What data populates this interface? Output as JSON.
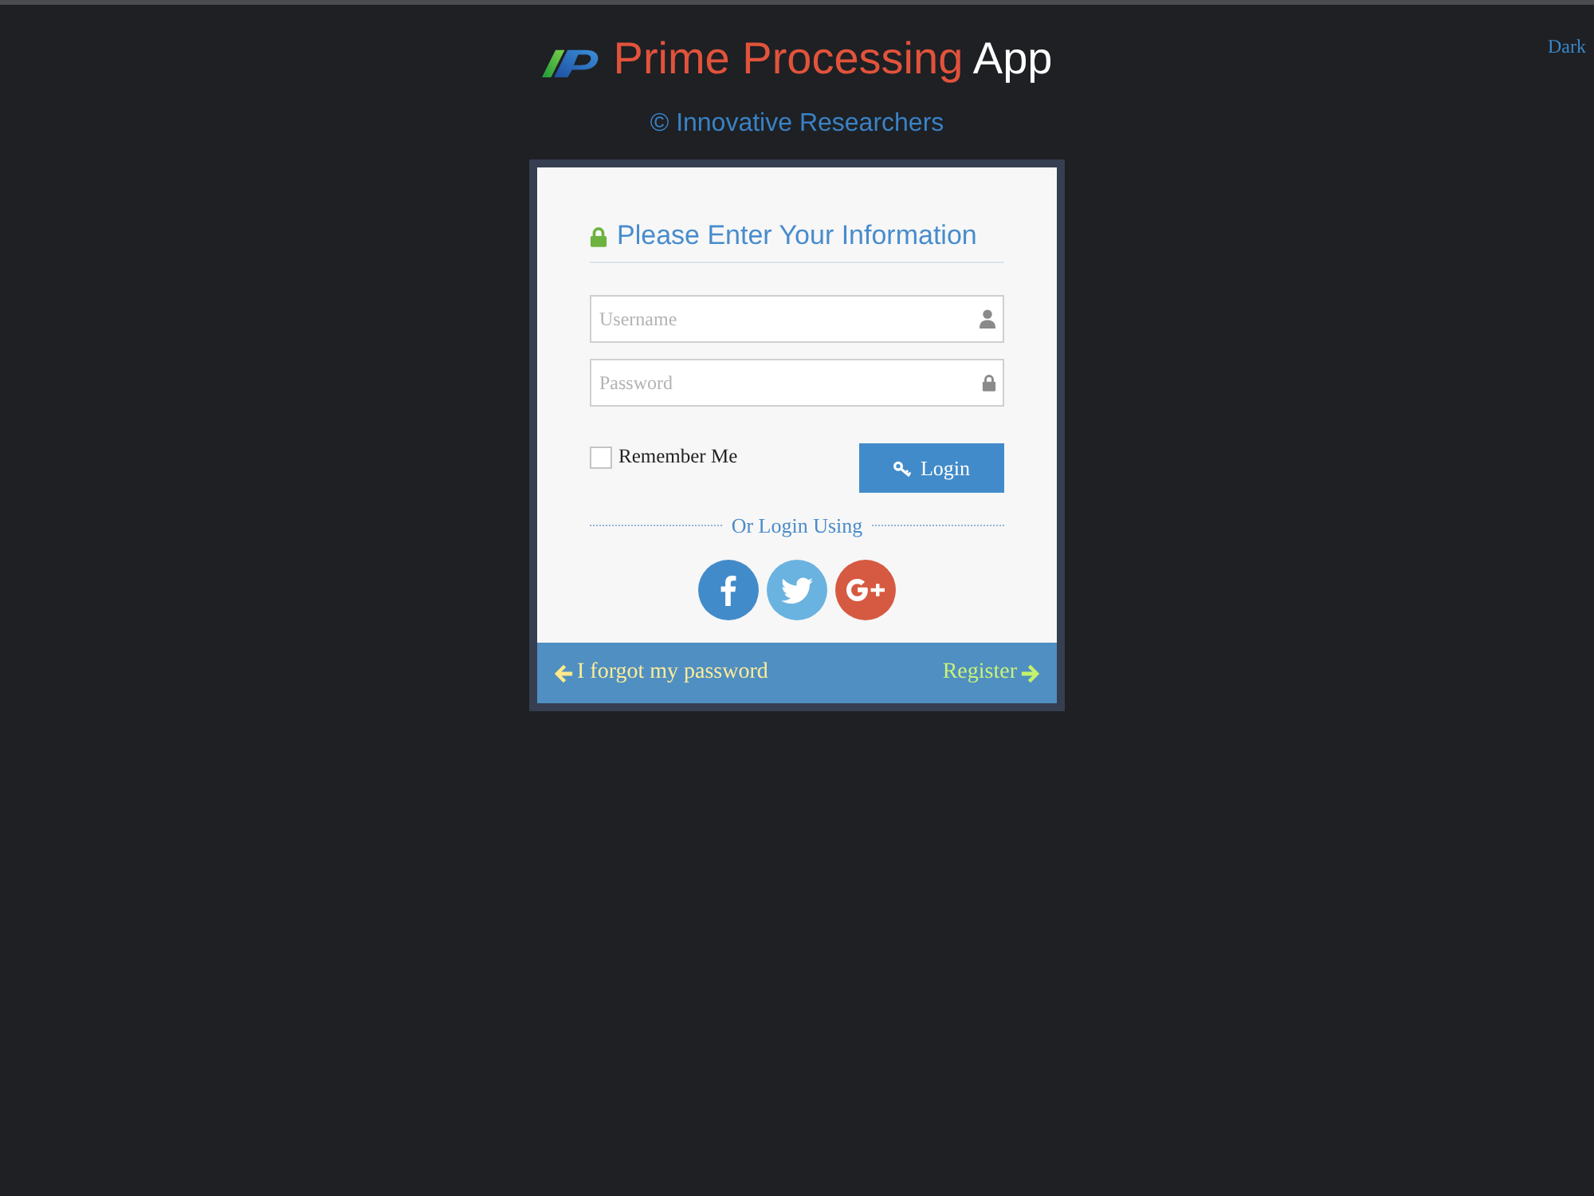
{
  "header": {
    "app_name": "Prime Processing",
    "app_suffix": "App",
    "copyright": "© Innovative Researchers"
  },
  "theme_link": {
    "label": "Dark"
  },
  "login_card": {
    "heading": "Please Enter Your Information",
    "fields": [
      {
        "kind": "text",
        "placeholder": "Username"
      },
      {
        "kind": "password",
        "placeholder": "Password"
      }
    ],
    "remember": {
      "label": "Remember Me",
      "checked": false
    },
    "submit": {
      "label": "Login"
    },
    "divider": "Or Login Using",
    "social": [
      {
        "kind": "facebook",
        "color": "#428bca"
      },
      {
        "kind": "twitter",
        "color": "#6ab3e0"
      },
      {
        "kind": "google",
        "color": "#d65a41"
      }
    ]
  },
  "footer": {
    "forgot": "I forgot my password",
    "register": "Register"
  }
}
